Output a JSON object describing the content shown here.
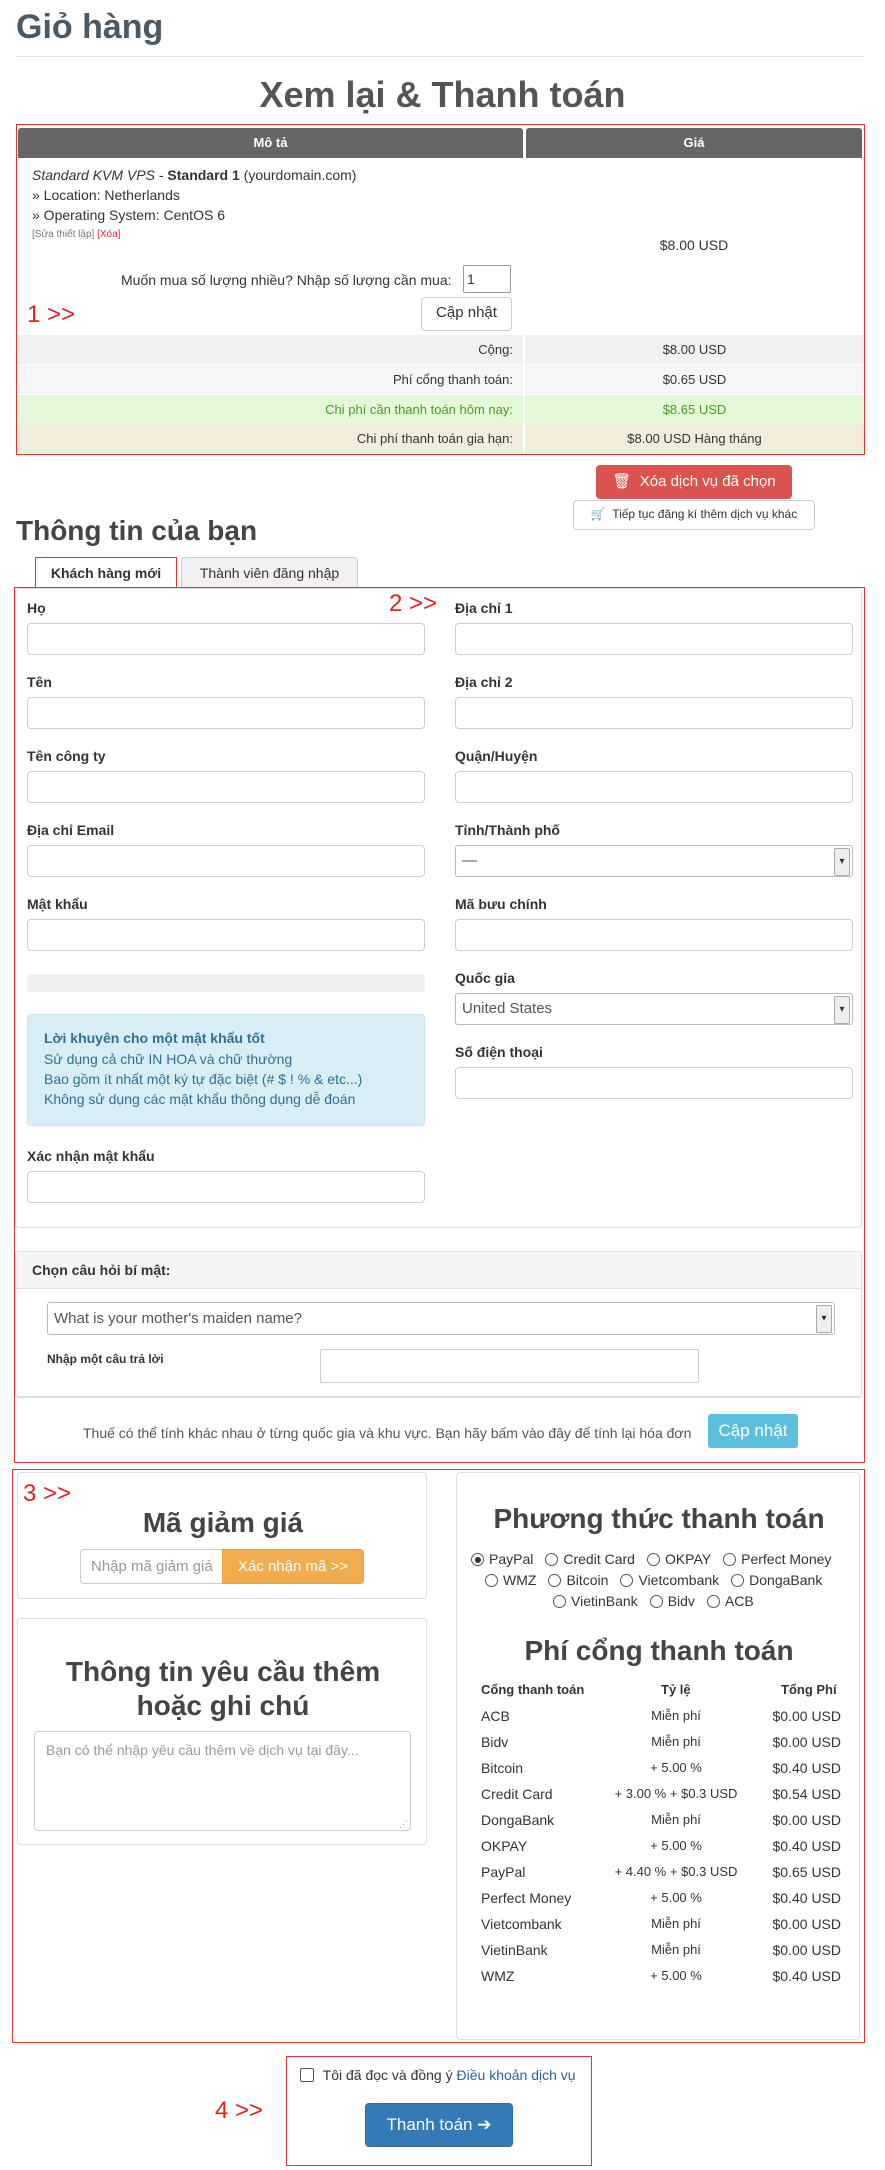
{
  "page_title": "Giỏ hàng",
  "review_title": "Xem lại & Thanh toán",
  "cart": {
    "col_desc": "Mô tả",
    "col_price": "Giá",
    "product_name": "Standard KVM VPS",
    "product_plan": "Standard 1",
    "product_domain": "(yourdomain.com)",
    "location": "» Location: Netherlands",
    "os": "» Operating System: CentOS 6",
    "edit_link": "[Sửa thiết lập]",
    "delete_link": "[Xóa]",
    "item_price": "$8.00 USD",
    "qty_prompt": "Muốn mua số lượng nhiều? Nhập số lượng cần mua:",
    "qty_value": "1",
    "update_btn": "Cập nhật",
    "subtotal_label": "Cộng:",
    "subtotal_value": "$8.00 USD",
    "gateway_fee_label": "Phí cổng thanh toán:",
    "gateway_fee_value": "$0.65 USD",
    "due_today_label": "Chi phí cần thanh toán hôm nay:",
    "due_today_value": "$8.65 USD",
    "recurring_label": "Chi phí thanh toán gia hạn:",
    "recurring_value": "$8.00 USD Hàng tháng",
    "empty_cart_btn": "Xóa dịch vụ đã chọn",
    "continue_btn": "Tiếp tục đăng kí thêm dịch vụ khác"
  },
  "markers": {
    "m1": "1 >>",
    "m2": "2 >>",
    "m3": "3 >>",
    "m4": "4 >>"
  },
  "info": {
    "title": "Thông tin của bạn",
    "tab_new": "Khách hàng mới",
    "tab_login": "Thành viên đăng nhập",
    "last_name": "Họ",
    "first_name": "Tên",
    "company": "Tên công ty",
    "email": "Địa chỉ Email",
    "password": "Mật khẩu",
    "address1": "Địa chỉ 1",
    "address2": "Địa chỉ 2",
    "district": "Quận/Huyện",
    "province": "Tỉnh/Thành phố",
    "province_value": "—",
    "postcode": "Mã bưu chính",
    "country": "Quốc gia",
    "country_value": "United States",
    "phone": "Số điện thoại",
    "tips_title": "Lời khuyên cho một mật khẩu tốt",
    "tip1": "Sử dụng cả chữ IN HOA và chữ thường",
    "tip2": "Bao gồm ít nhất một ký tự đặc biệt (# $ ! % & etc...)",
    "tip3": "Không sử dụng các mật khẩu thông dụng dễ đoán",
    "confirm_password": "Xác nhận mật khẩu",
    "security_q_title": "Chọn câu hỏi bí mật:",
    "security_q_value": "What is your mother's maiden name?",
    "security_answer": "Nhập một câu trả lời",
    "tax_note": "Thuế có thể tính khác nhau ở từng quốc gia và khu vực. Bạn hãy bấm vào đây để tính lại hóa đơn",
    "tax_update_btn": "Cập nhật"
  },
  "promo": {
    "title": "Mã giảm giá",
    "placeholder": "Nhập mã giảm giá",
    "apply_btn": "Xác nhận mã >>"
  },
  "notes": {
    "title": "Thông tin yêu cầu thêm hoặc ghi chú",
    "placeholder": "Bạn có thể nhập yêu cầu thêm về dịch vụ tại đây..."
  },
  "payment": {
    "title": "Phương thức thanh toán",
    "methods": [
      "PayPal",
      "Credit Card",
      "OKPAY",
      "Perfect Money",
      "WMZ",
      "Bitcoin",
      "Vietcombank",
      "DongaBank",
      "VietinBank",
      "Bidv",
      "ACB"
    ],
    "selected": "PayPal",
    "fee_title": "Phí cổng thanh toán",
    "fee_headers": [
      "Cổng thanh toán",
      "Tỷ lệ",
      "Tổng Phí"
    ],
    "fees": [
      [
        "ACB",
        "Miễn phí",
        "$0.00 USD"
      ],
      [
        "Bidv",
        "Miễn phí",
        "$0.00 USD"
      ],
      [
        "Bitcoin",
        "+ 5.00 %",
        "$0.40 USD"
      ],
      [
        "Credit Card",
        "+ 3.00 % + $0.3 USD",
        "$0.54 USD"
      ],
      [
        "DongaBank",
        "Miễn phí",
        "$0.00 USD"
      ],
      [
        "OKPAY",
        "+ 5.00 %",
        "$0.40 USD"
      ],
      [
        "PayPal",
        "+ 4.40 % + $0.3 USD",
        "$0.65 USD"
      ],
      [
        "Perfect Money",
        "+ 5.00 %",
        "$0.40 USD"
      ],
      [
        "Vietcombank",
        "Miễn phí",
        "$0.00 USD"
      ],
      [
        "VietinBank",
        "Miễn phí",
        "$0.00 USD"
      ],
      [
        "WMZ",
        "+ 5.00 %",
        "$0.40 USD"
      ]
    ]
  },
  "checkout": {
    "tos_prefix": "Tôi đã đọc và đồng ý",
    "tos_link": "Điều khoản dịch vụ",
    "submit_btn": "Thanh toán"
  },
  "colors": {
    "accent_red": "#d9534f",
    "accent_blue": "#337ab7",
    "accent_info": "#5bc0de",
    "accent_orange": "#f0ad4e"
  }
}
